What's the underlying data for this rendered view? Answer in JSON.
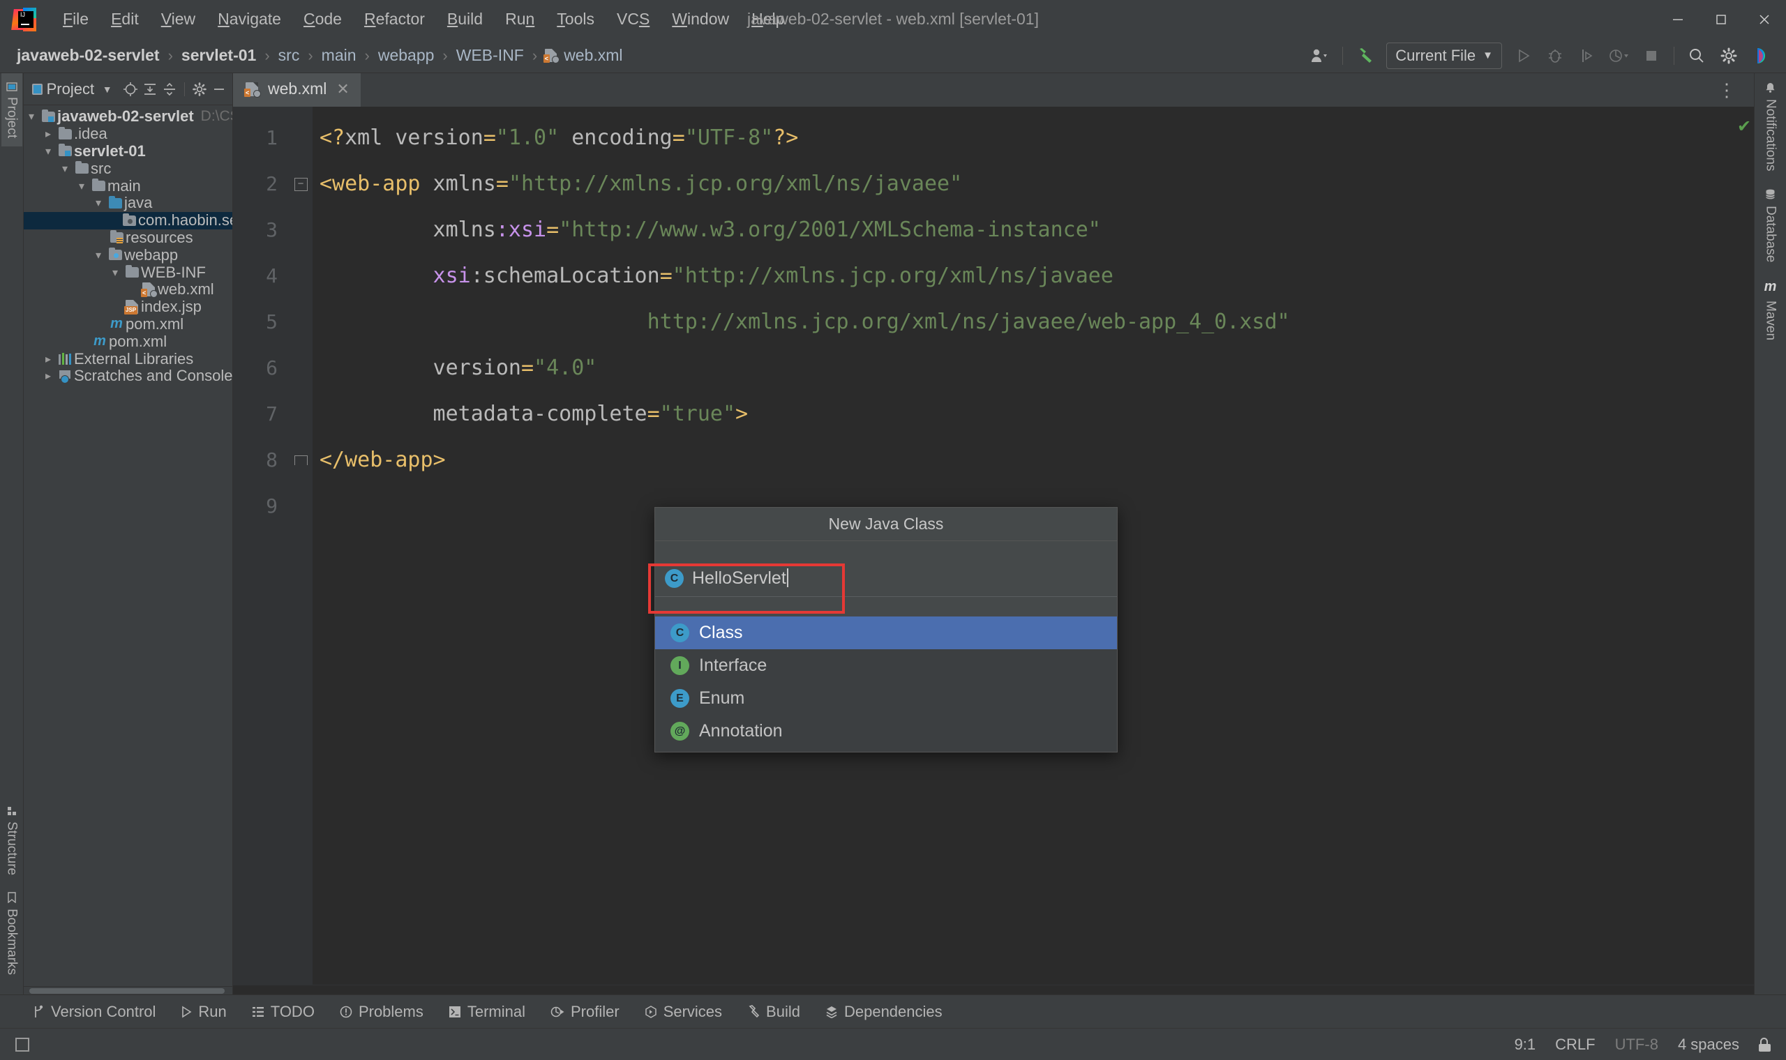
{
  "window": {
    "title": "javaweb-02-servlet - web.xml [servlet-01]",
    "minimize_label": "—",
    "maximize_label": "❐",
    "close_label": "✕"
  },
  "menu": [
    {
      "label": "File",
      "mnemonic": "F"
    },
    {
      "label": "Edit",
      "mnemonic": "E"
    },
    {
      "label": "View",
      "mnemonic": "V"
    },
    {
      "label": "Navigate",
      "mnemonic": "N"
    },
    {
      "label": "Code",
      "mnemonic": "C"
    },
    {
      "label": "Refactor",
      "mnemonic": "R"
    },
    {
      "label": "Build",
      "mnemonic": "B"
    },
    {
      "label": "Run",
      "mnemonic": "n"
    },
    {
      "label": "Tools",
      "mnemonic": "T"
    },
    {
      "label": "VCS",
      "mnemonic": "S"
    },
    {
      "label": "Window",
      "mnemonic": "W"
    },
    {
      "label": "Help",
      "mnemonic": "H"
    }
  ],
  "navbar": {
    "crumbs": [
      {
        "label": "javaweb-02-servlet",
        "bold": true
      },
      {
        "label": "servlet-01",
        "bold": true
      },
      {
        "label": "src",
        "bold": false
      },
      {
        "label": "main",
        "bold": false
      },
      {
        "label": "webapp",
        "bold": false
      },
      {
        "label": "WEB-INF",
        "bold": false
      },
      {
        "label": "web.xml",
        "bold": false,
        "icon": "xml-file-icon"
      }
    ],
    "separator": "›",
    "run_config": "Current File",
    "tools": [
      "user-account-icon",
      "build-hammer-icon",
      "run-icon",
      "debug-icon",
      "run-with-coverage-icon",
      "profile-icon",
      "stop-icon",
      "search-everywhere-icon",
      "settings-gear-icon",
      "ide-assistant-icon"
    ]
  },
  "left_rail": [
    {
      "label": "Project",
      "icon": "project-folder-icon",
      "active": true
    },
    {
      "label": "Structure",
      "icon": "structure-icon",
      "active": false
    },
    {
      "label": "Bookmarks",
      "icon": "bookmarks-icon",
      "active": false
    }
  ],
  "right_rail": [
    {
      "label": "Notifications",
      "icon": "bell-icon"
    },
    {
      "label": "Database",
      "icon": "database-icon"
    },
    {
      "label": "Maven",
      "icon": "maven-m-icon"
    }
  ],
  "project_panel": {
    "title": "Project",
    "buttons": [
      "select-opened-file-icon",
      "expand-all-icon",
      "collapse-all-icon",
      "settings-gear-icon",
      "hide-icon"
    ],
    "tree": [
      {
        "label": "javaweb-02-servlet",
        "path": "D:\\CSApp\\AllC",
        "depth": 0,
        "chev": "down",
        "icon": "module-folder",
        "bold": true
      },
      {
        "label": ".idea",
        "depth": 1,
        "chev": "right",
        "icon": "folder"
      },
      {
        "label": "servlet-01",
        "depth": 1,
        "chev": "down",
        "icon": "module-folder",
        "bold": true
      },
      {
        "label": "src",
        "depth": 2,
        "chev": "down",
        "icon": "folder"
      },
      {
        "label": "main",
        "depth": 3,
        "chev": "down",
        "icon": "folder"
      },
      {
        "label": "java",
        "depth": 4,
        "chev": "down",
        "icon": "source-folder"
      },
      {
        "label": "com.haobin.servlet",
        "depth": 5,
        "chev": "none",
        "icon": "package-folder",
        "selected": true
      },
      {
        "label": "resources",
        "depth": 5,
        "chev": "none",
        "icon": "resource-folder"
      },
      {
        "label": "webapp",
        "depth": 4,
        "chev": "down",
        "icon": "web-folder"
      },
      {
        "label": "WEB-INF",
        "depth": 5,
        "chev": "down",
        "icon": "folder"
      },
      {
        "label": "web.xml",
        "depth": 6,
        "chev": "none",
        "icon": "xml-file"
      },
      {
        "label": "index.jsp",
        "depth": 5,
        "chev": "none",
        "icon": "jsp-file"
      },
      {
        "label": "pom.xml",
        "depth": 4,
        "chev": "none",
        "icon": "maven-file"
      },
      {
        "label": "pom.xml",
        "depth": 2,
        "chev": "none",
        "icon": "maven-file"
      },
      {
        "label": "External Libraries",
        "depth": 1,
        "chev": "right",
        "icon": "libraries"
      },
      {
        "label": "Scratches and Consoles",
        "depth": 1,
        "chev": "right",
        "icon": "scratches"
      }
    ]
  },
  "editor": {
    "tab": {
      "label": "web.xml",
      "icon": "xml-file-icon",
      "close": "✕"
    },
    "kebab": "⋮",
    "inspection_status": "✔",
    "line_numbers": [
      "1",
      "2",
      "3",
      "4",
      "5",
      "6",
      "7",
      "8",
      "9"
    ],
    "lines": [
      [
        {
          "t": "<?",
          "c": "t-punct"
        },
        {
          "t": "xml ",
          "c": "t-pi"
        },
        {
          "t": "version",
          "c": "t-attr"
        },
        {
          "t": "=",
          "c": "t-punct"
        },
        {
          "t": "\"1.0\"",
          "c": "t-str"
        },
        {
          "t": " encoding",
          "c": "t-attr"
        },
        {
          "t": "=",
          "c": "t-punct"
        },
        {
          "t": "\"UTF-8\"",
          "c": "t-str"
        },
        {
          "t": "?>",
          "c": "t-punct"
        }
      ],
      [
        {
          "t": "<web-app",
          "c": "t-tag"
        },
        {
          "t": " xmlns",
          "c": "t-attr"
        },
        {
          "t": "=",
          "c": "t-punct"
        },
        {
          "t": "\"http://xmlns.jcp.org/xml/ns/javaee\"",
          "c": "t-str"
        }
      ],
      [
        {
          "t": "         xmlns",
          "c": "t-attr"
        },
        {
          "t": ":xsi",
          "c": "t-ns"
        },
        {
          "t": "=",
          "c": "t-punct"
        },
        {
          "t": "\"http://www.w3.org/2001/XMLSchema-instance\"",
          "c": "t-str"
        }
      ],
      [
        {
          "t": "         xsi",
          "c": "t-ns"
        },
        {
          "t": ":schemaLocation",
          "c": "t-attr"
        },
        {
          "t": "=",
          "c": "t-punct"
        },
        {
          "t": "\"http://xmlns.jcp.org/xml/ns/javaee",
          "c": "t-str"
        }
      ],
      [
        {
          "t": "                          http://xmlns.jcp.org/xml/ns/javaee/web-app_4_0.xsd\"",
          "c": "t-str"
        }
      ],
      [
        {
          "t": "         version",
          "c": "t-attr"
        },
        {
          "t": "=",
          "c": "t-punct"
        },
        {
          "t": "\"4.0\"",
          "c": "t-str"
        }
      ],
      [
        {
          "t": "         metadata-complete",
          "c": "t-attr"
        },
        {
          "t": "=",
          "c": "t-punct"
        },
        {
          "t": "\"true\"",
          "c": "t-str"
        },
        {
          "t": ">",
          "c": "t-tag"
        }
      ],
      [
        {
          "t": "</web-app>",
          "c": "t-tag"
        }
      ],
      [
        {
          "t": "",
          "c": "t-attr"
        }
      ]
    ]
  },
  "popup": {
    "title": "New Java Class",
    "input_value": "HelloServlet",
    "input_icon": "class-icon",
    "items": [
      {
        "label": "Class",
        "icon": "C",
        "color": "teal",
        "selected": true
      },
      {
        "label": "Interface",
        "icon": "I",
        "color": "green",
        "selected": false
      },
      {
        "label": "Enum",
        "icon": "E",
        "color": "teal",
        "selected": false
      },
      {
        "label": "Annotation",
        "icon": "@",
        "color": "green",
        "selected": false
      }
    ]
  },
  "statusbar": {
    "tools": [
      {
        "label": "Version Control",
        "icon": "branch-icon"
      },
      {
        "label": "Run",
        "icon": "play-icon"
      },
      {
        "label": "TODO",
        "icon": "list-icon"
      },
      {
        "label": "Problems",
        "icon": "warning-icon"
      },
      {
        "label": "Terminal",
        "icon": "terminal-icon"
      },
      {
        "label": "Profiler",
        "icon": "profiler-icon"
      },
      {
        "label": "Services",
        "icon": "services-icon"
      },
      {
        "label": "Build",
        "icon": "hammer-icon"
      },
      {
        "label": "Dependencies",
        "icon": "dependencies-icon"
      }
    ],
    "caret_position": "9:1",
    "line_separator": "CRLF",
    "encoding": "UTF-8",
    "indent": "4 spaces",
    "lock_icon": "unlocked-icon"
  },
  "colors": {
    "bg": "#3c3f41",
    "editor_bg": "#2b2b2b",
    "selection": "#0d293e",
    "accent_blue": "#4b6eaf",
    "string_green": "#6a8759",
    "tag_amber": "#e8bf6a",
    "ns_purple": "#c792ea",
    "annotation_red": "#e53935"
  }
}
